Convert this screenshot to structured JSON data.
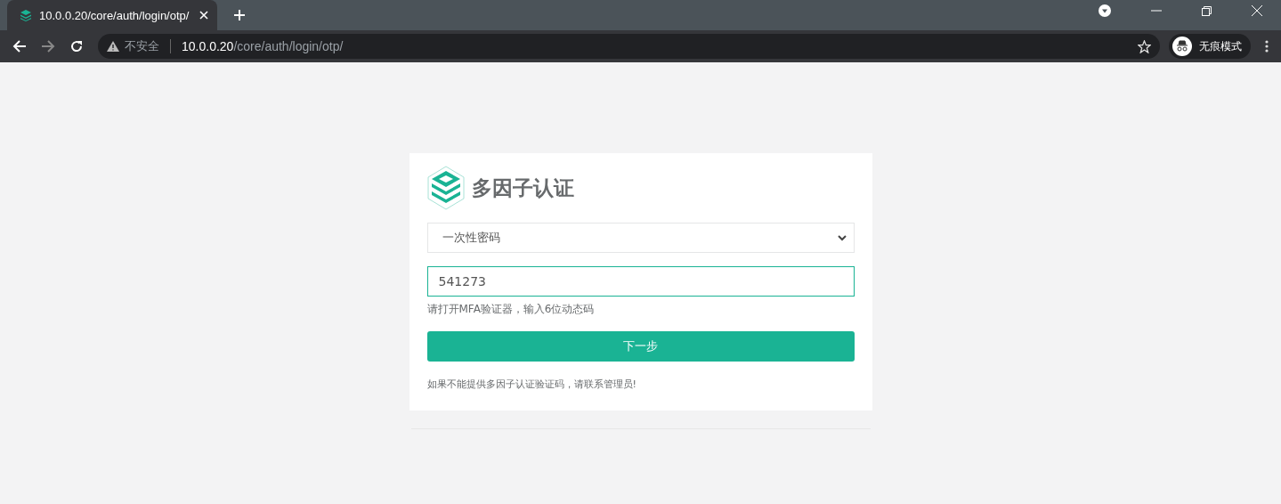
{
  "browser": {
    "tab": {
      "title": "10.0.0.20/core/auth/login/otp/",
      "selected": true
    },
    "security_label": "不安全",
    "url_host": "10.0.0.20",
    "url_path": "/core/auth/login/otp/",
    "profile_label": "无痕模式"
  },
  "card": {
    "title": "多因子认证",
    "method_select": {
      "value": "一次性密码"
    },
    "otp_input": {
      "value": "541273",
      "focused": true
    },
    "hint": "请打开MFA验证器，输入6位动态码",
    "submit_button": "下一步",
    "footer_note": "如果不能提供多因子认证验证码，请联系管理员!"
  }
}
